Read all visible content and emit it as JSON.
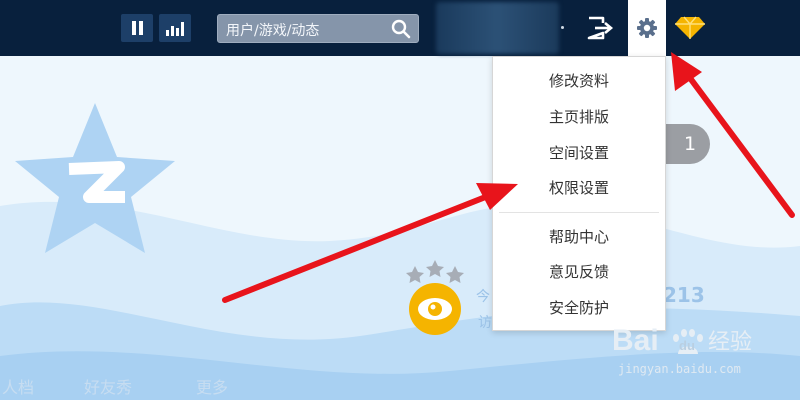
{
  "topbar": {
    "search": {
      "placeholder": "用户/游戏/动态",
      "icon": "search-icon"
    },
    "icons": [
      "pause-icon",
      "stats-icon",
      "logout-icon",
      "gear-icon",
      "diamond-icon"
    ]
  },
  "settings_menu": {
    "items": [
      "修改资料",
      "主页排版",
      "空间设置",
      "权限设置"
    ],
    "items2": [
      "帮助中心",
      "意见反馈",
      "安全防护"
    ]
  },
  "background": {
    "badge": "1",
    "visitor_count_partial": "213",
    "partial_a": "今",
    "partial_b": "访",
    "tabs_faint": [
      "人档",
      "好友秀",
      "更多"
    ]
  },
  "watermark": {
    "brand": "Bai",
    "brand2": "du",
    "brand3": "经验",
    "url": "jingyan.baidu.com"
  },
  "colors": {
    "topbar": "#08203d",
    "arrow": "#e8141b",
    "accent_gold": "#f5b400"
  }
}
